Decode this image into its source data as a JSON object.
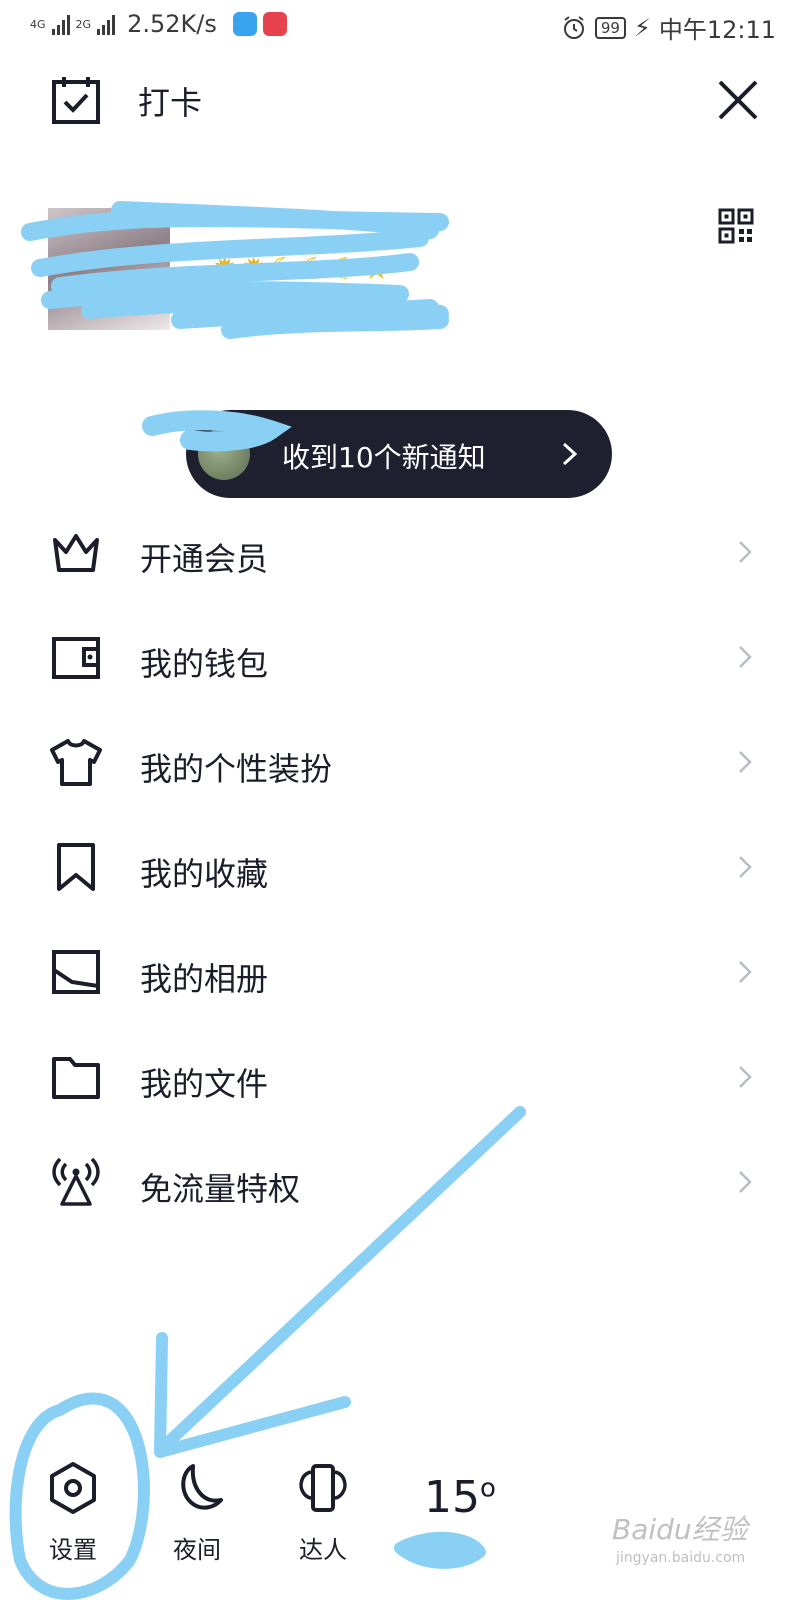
{
  "status_bar": {
    "network1": "4G",
    "network2": "2G",
    "speed": "2.52K/s",
    "battery": "99",
    "time": "中午12:11"
  },
  "header": {
    "title": "打卡"
  },
  "notification": {
    "text": "收到10个新通知"
  },
  "menu": {
    "items": [
      {
        "label": "开通会员",
        "icon": "crown-icon"
      },
      {
        "label": "我的钱包",
        "icon": "wallet-icon"
      },
      {
        "label": "我的个性装扮",
        "icon": "tshirt-icon"
      },
      {
        "label": "我的收藏",
        "icon": "bookmark-icon"
      },
      {
        "label": "我的相册",
        "icon": "photo-album-icon"
      },
      {
        "label": "我的文件",
        "icon": "folder-icon"
      },
      {
        "label": "免流量特权",
        "icon": "signal-tower-icon"
      }
    ]
  },
  "bottom_bar": {
    "settings_label": "设置",
    "night_label": "夜间",
    "expert_label": "达人",
    "temperature": "15"
  },
  "watermark": {
    "brand": "Baidu经验",
    "url": "jingyan.baidu.com"
  },
  "colors": {
    "text": "#1b1d2a",
    "pill_bg": "#1e2030",
    "annotation": "#8ad0f5",
    "chevron": "#b8bcc6"
  }
}
